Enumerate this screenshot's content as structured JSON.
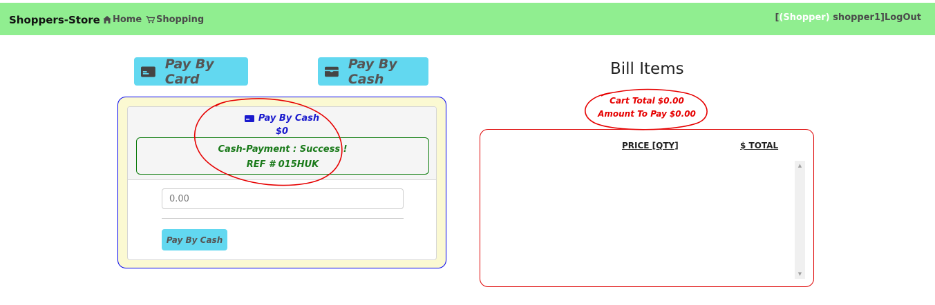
{
  "navbar": {
    "brand": "Shoppers-Store",
    "home_label": "Home",
    "shopping_label": "Shopping",
    "user_open": "[",
    "user_role": "(Shopper)",
    "user_name": " shopper1]",
    "logout_label": "LogOut",
    "background": "#90ee90"
  },
  "methods": {
    "card_label": "Pay By Card",
    "cash_label": "Pay By Cash",
    "accent": "#62d8f0"
  },
  "payment": {
    "header_title": "Pay By Cash",
    "header_amount": "$0",
    "status_message": "Cash-Payment : Success !",
    "reference": "REF # 015HUK",
    "amount_placeholder": "0.00",
    "submit_label": "Pay By Cash"
  },
  "bill": {
    "title": "Bill Items",
    "cart_total": "Cart Total $0.00",
    "amount_to_pay": "Amount To Pay $0.00",
    "columns": [
      "PRICE [QTY]",
      "$ TOTAL"
    ],
    "rows": []
  },
  "icons": {
    "home": "home-icon",
    "cart": "cart-icon",
    "card": "credit-card-icon",
    "cash": "wallet-icon"
  },
  "colors": {
    "annotation": "#e60000",
    "panel_border": "#0000ee",
    "success": "#1a7a1a"
  }
}
